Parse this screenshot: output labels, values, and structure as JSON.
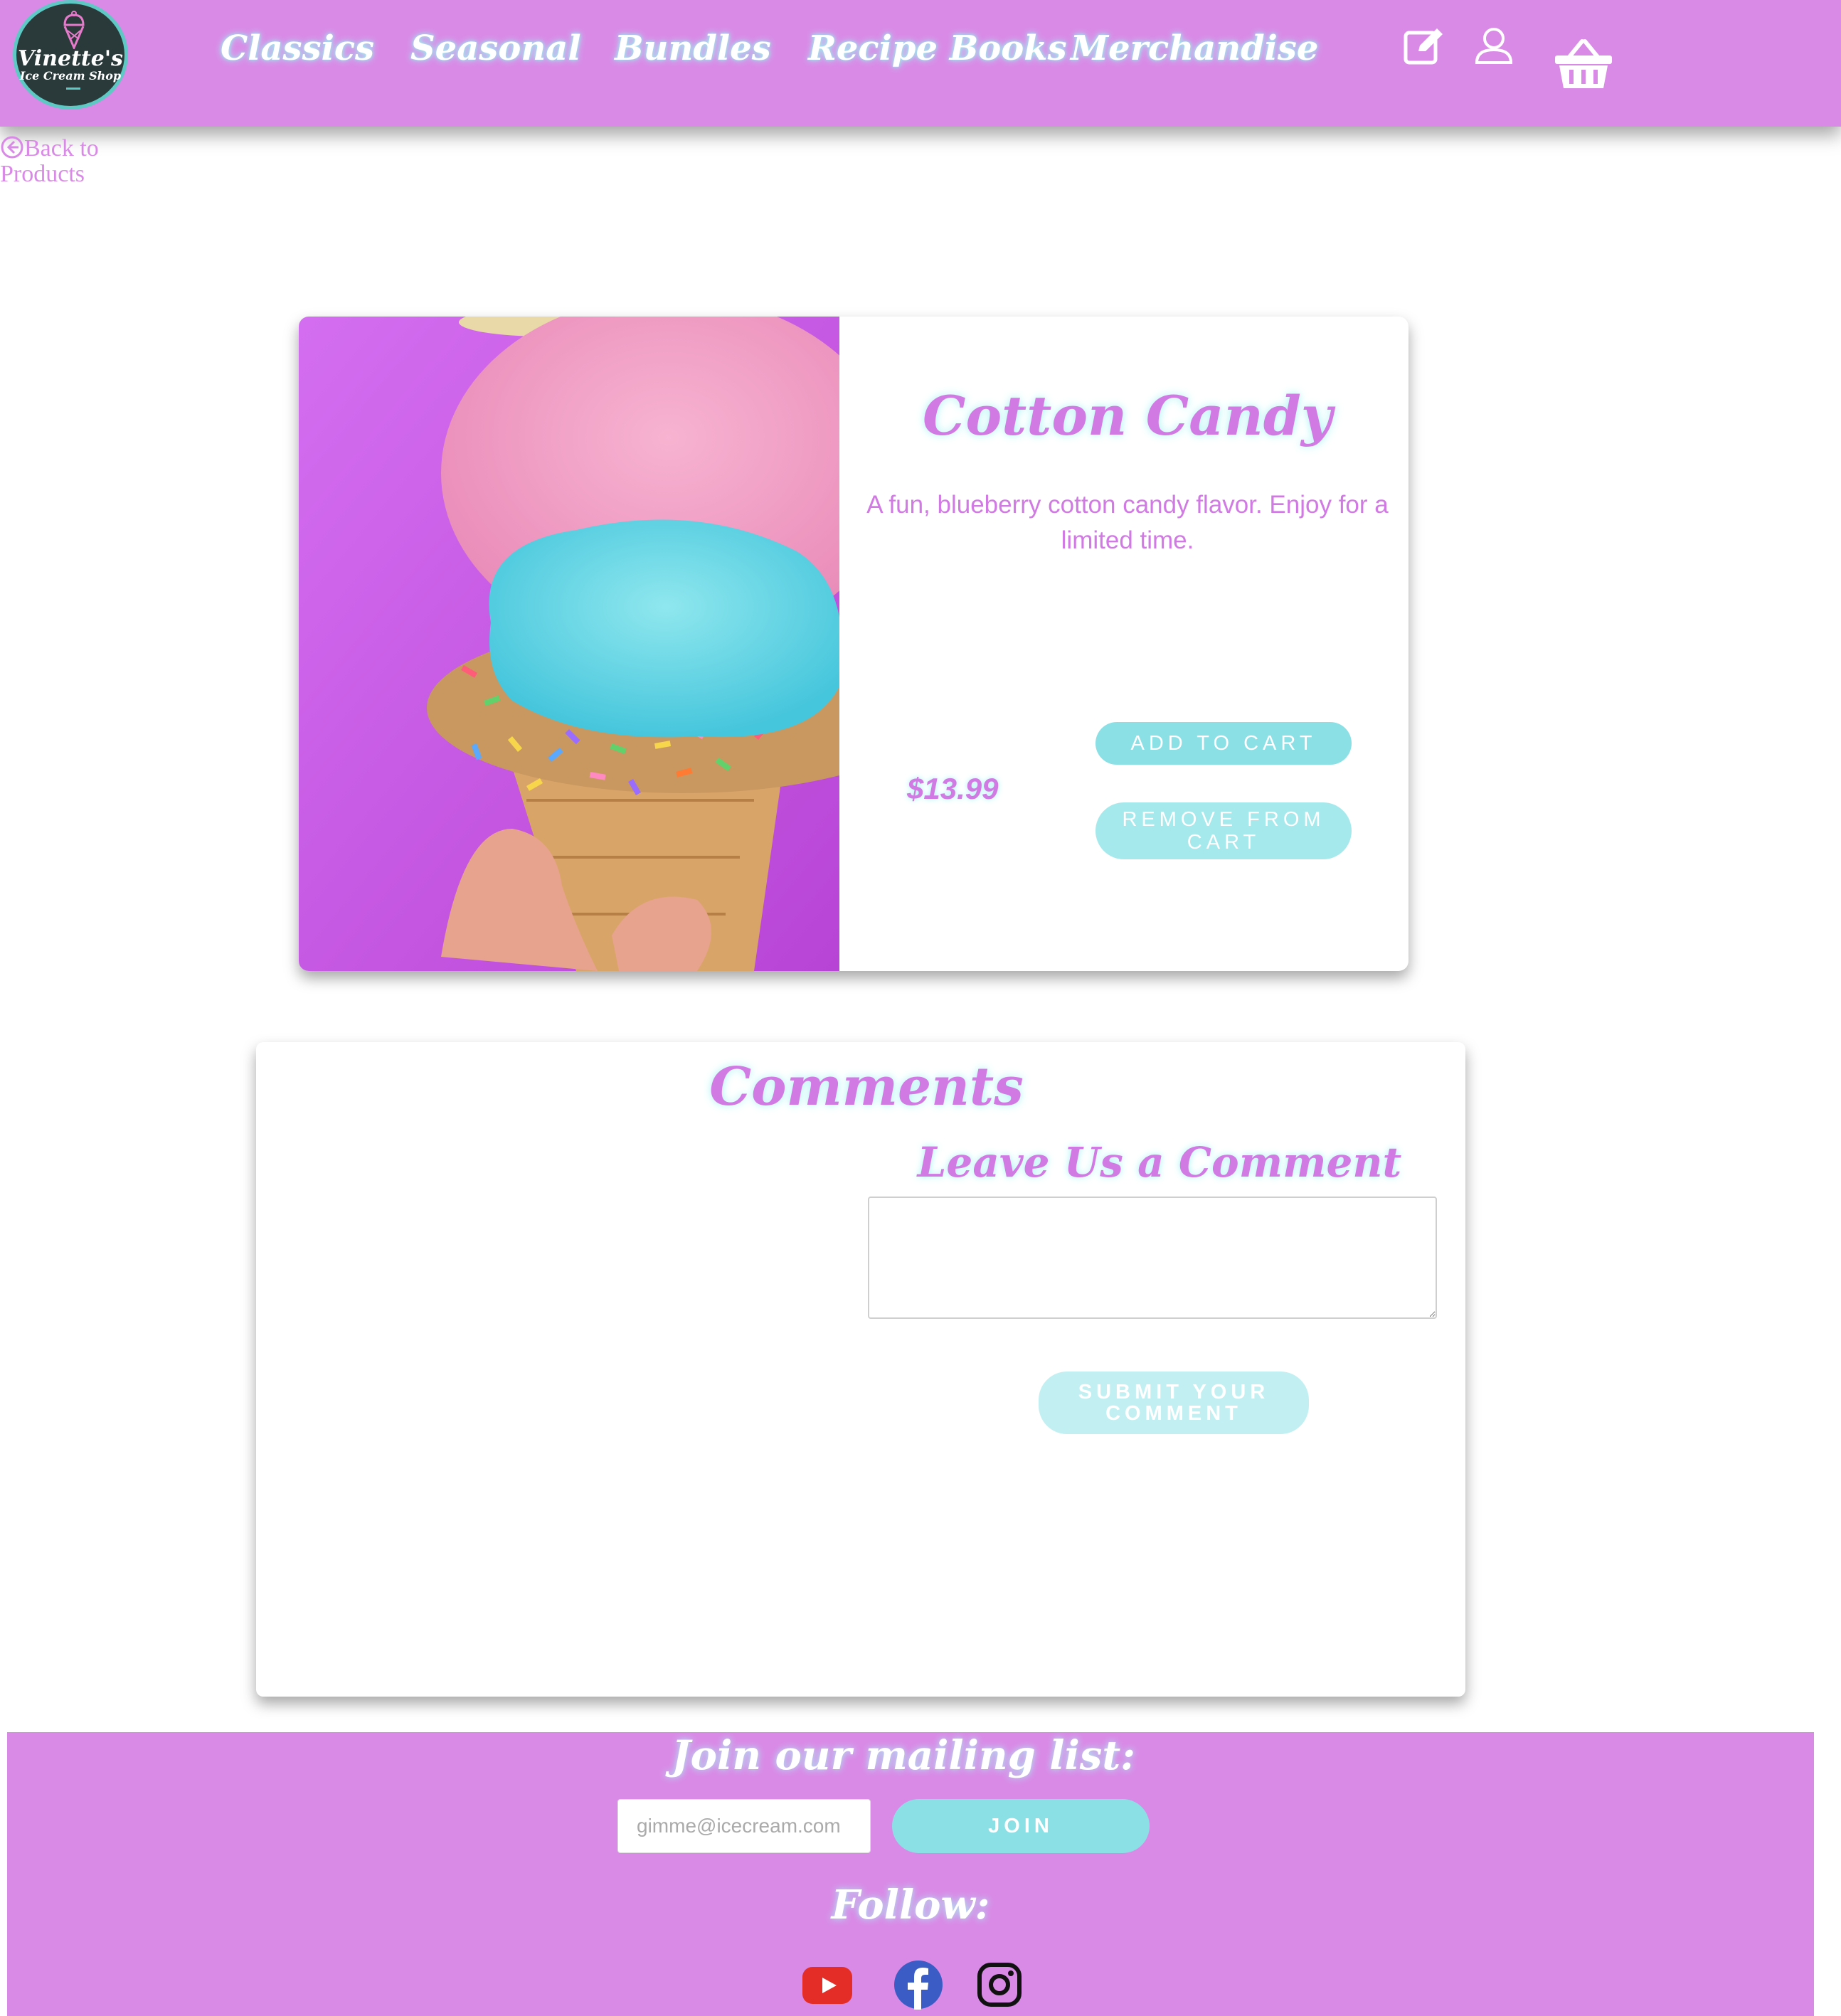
{
  "header": {
    "logo": {
      "line1": "Vinette's",
      "line2": "Ice Cream Shop"
    },
    "nav": [
      {
        "label": "Classics"
      },
      {
        "label": "Seasonal"
      },
      {
        "label": "Bundles"
      },
      {
        "label": "Recipe Books"
      },
      {
        "label": "Merchandise"
      }
    ],
    "icons": [
      "edit-icon",
      "user-icon",
      "basket-icon"
    ]
  },
  "back_link": {
    "label": "Back to Products"
  },
  "product": {
    "name": "Cotton Candy",
    "description": "A fun, blueberry cotton candy flavor. Enjoy for a limited time.",
    "price": "$13.99",
    "add_label": "ADD TO CART",
    "remove_label": "REMOVE FROM CART"
  },
  "comments": {
    "title": "Comments",
    "form_heading": "Leave Us a Comment",
    "textarea_value": "",
    "submit_label": "SUBMIT YOUR COMMENT"
  },
  "footer": {
    "mailing_title": "Join our mailing list:",
    "email_placeholder": "gimme@icecream.com",
    "join_label": "JOIN",
    "follow_title": "Follow:",
    "social_icons": [
      "youtube-icon",
      "facebook-icon",
      "instagram-icon"
    ]
  },
  "colors": {
    "brand": "#d98ae6",
    "accent": "#8be0e6",
    "text": "#d17ae4"
  }
}
